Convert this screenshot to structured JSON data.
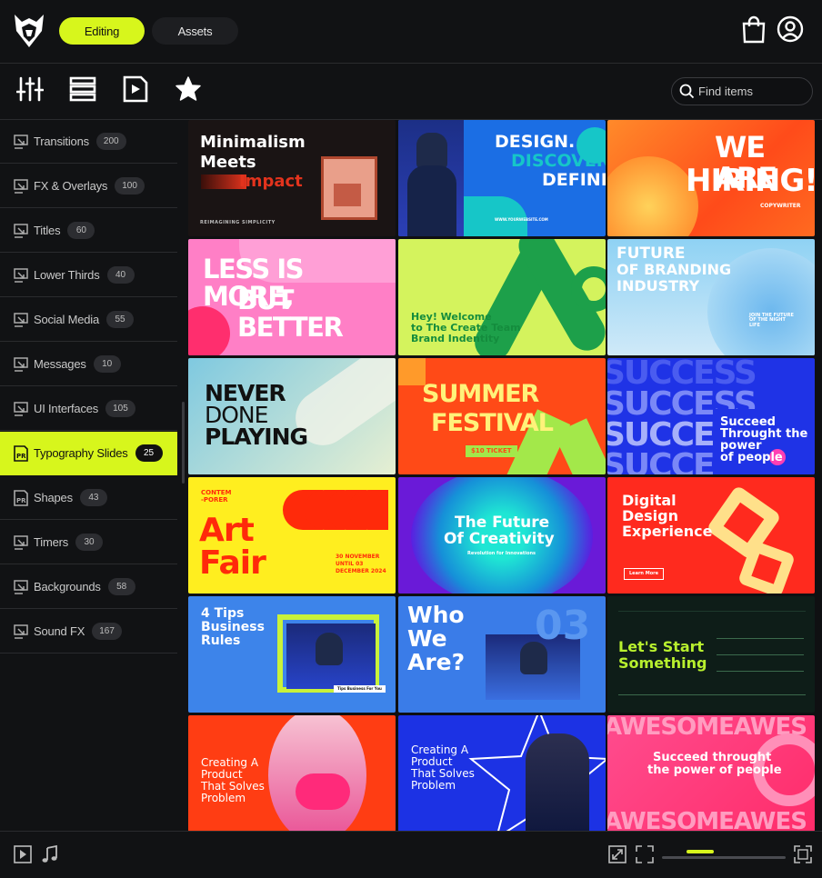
{
  "topbar": {
    "tabs": [
      {
        "label": "Editing"
      },
      {
        "label": "Assets"
      }
    ],
    "icons": [
      "logo-icon",
      "shopping-bag-icon",
      "user-profile-icon"
    ]
  },
  "toolbar": {
    "icons": [
      "sliders-icon",
      "layout-list-icon",
      "play-document-icon",
      "star-icon"
    ],
    "search": {
      "placeholder": "Find items"
    }
  },
  "sidebar": {
    "items": [
      {
        "label": "Transitions",
        "count": "200"
      },
      {
        "label": "FX & Overlays",
        "count": "100"
      },
      {
        "label": "Titles",
        "count": "60"
      },
      {
        "label": "Lower Thirds",
        "count": "40"
      },
      {
        "label": "Social Media",
        "count": "55"
      },
      {
        "label": "Messages",
        "count": "10"
      },
      {
        "label": "UI Interfaces",
        "count": "105"
      },
      {
        "label": "Typography Slides",
        "count": "25"
      },
      {
        "label": "Shapes",
        "count": "43"
      },
      {
        "label": "Timers",
        "count": "30"
      },
      {
        "label": "Backgrounds",
        "count": "58"
      },
      {
        "label": "Sound FX",
        "count": "167"
      }
    ]
  },
  "grid": {
    "cards": [
      {
        "lines": [
          "Minimalism",
          "Meets",
          "Impact"
        ],
        "sub": "REIMAGINING SIMPLICITY"
      },
      {
        "lines": [
          "DESIGN.",
          "DISCOVER.",
          "DEFINE."
        ],
        "sub": "WWW.YOURWEBSITE.COM"
      },
      {
        "lines": [
          "WE ARE",
          "HIRING!"
        ],
        "sub": "COPYWRITER"
      },
      {
        "lines": [
          "LESS IS MORE,",
          "BUT BETTER"
        ],
        "sub": ""
      },
      {
        "lines": [
          "Hey! Welcome",
          "to The Create Team",
          "Brand Indentity"
        ],
        "sub": ""
      },
      {
        "lines": [
          "FUTURE",
          "OF BRANDING",
          "INDUSTRY"
        ],
        "sub": "JOIN THE FUTURE OF THE NIGHT LIFE"
      },
      {
        "lines": [
          "NEVER",
          "DONE",
          "PLAYING"
        ],
        "sub": ""
      },
      {
        "lines": [
          "SUMMER",
          "FESTIVAL"
        ],
        "sub": "$10 TICKET"
      },
      {
        "lines": [
          "Succeed",
          "Throught the",
          "power",
          "of people"
        ],
        "sub": "SUCCESS"
      },
      {
        "lines": [
          "CONTEM",
          "-PORER",
          "Art",
          "Fair"
        ],
        "sub": "30 NOVEMBER UNTIL 03 DECEMBER 2024"
      },
      {
        "lines": [
          "The Future",
          "Of Creativity"
        ],
        "sub": "Revolution for Innovations"
      },
      {
        "lines": [
          "Digital",
          "Design",
          "Experience"
        ],
        "sub": "Learn More"
      },
      {
        "lines": [
          "4 Tips",
          "Business",
          "Rules"
        ],
        "sub": "Tips Business For You"
      },
      {
        "lines": [
          "Who",
          "We",
          "Are?"
        ],
        "sub": "03"
      },
      {
        "lines": [
          "Let's Start",
          "Something"
        ],
        "sub": ""
      },
      {
        "lines": [
          "Creating A",
          "Product",
          "That Solves",
          "Problem"
        ],
        "sub": ""
      },
      {
        "lines": [
          "Creating A",
          "Product",
          "That Solves",
          "Problem"
        ],
        "sub": ""
      },
      {
        "lines": [
          "Succeed throught",
          "the power of people"
        ],
        "sub": "AWESOMEAWES"
      }
    ]
  },
  "bottombar": {
    "icons": [
      "play-icon",
      "music-note-icon",
      "fit-screen-icon",
      "crop-frame-icon",
      "fullscreen-icon"
    ],
    "zoom": 0.25
  },
  "colors": {
    "accent": "#d7f61c",
    "bg": "#0f1012"
  }
}
